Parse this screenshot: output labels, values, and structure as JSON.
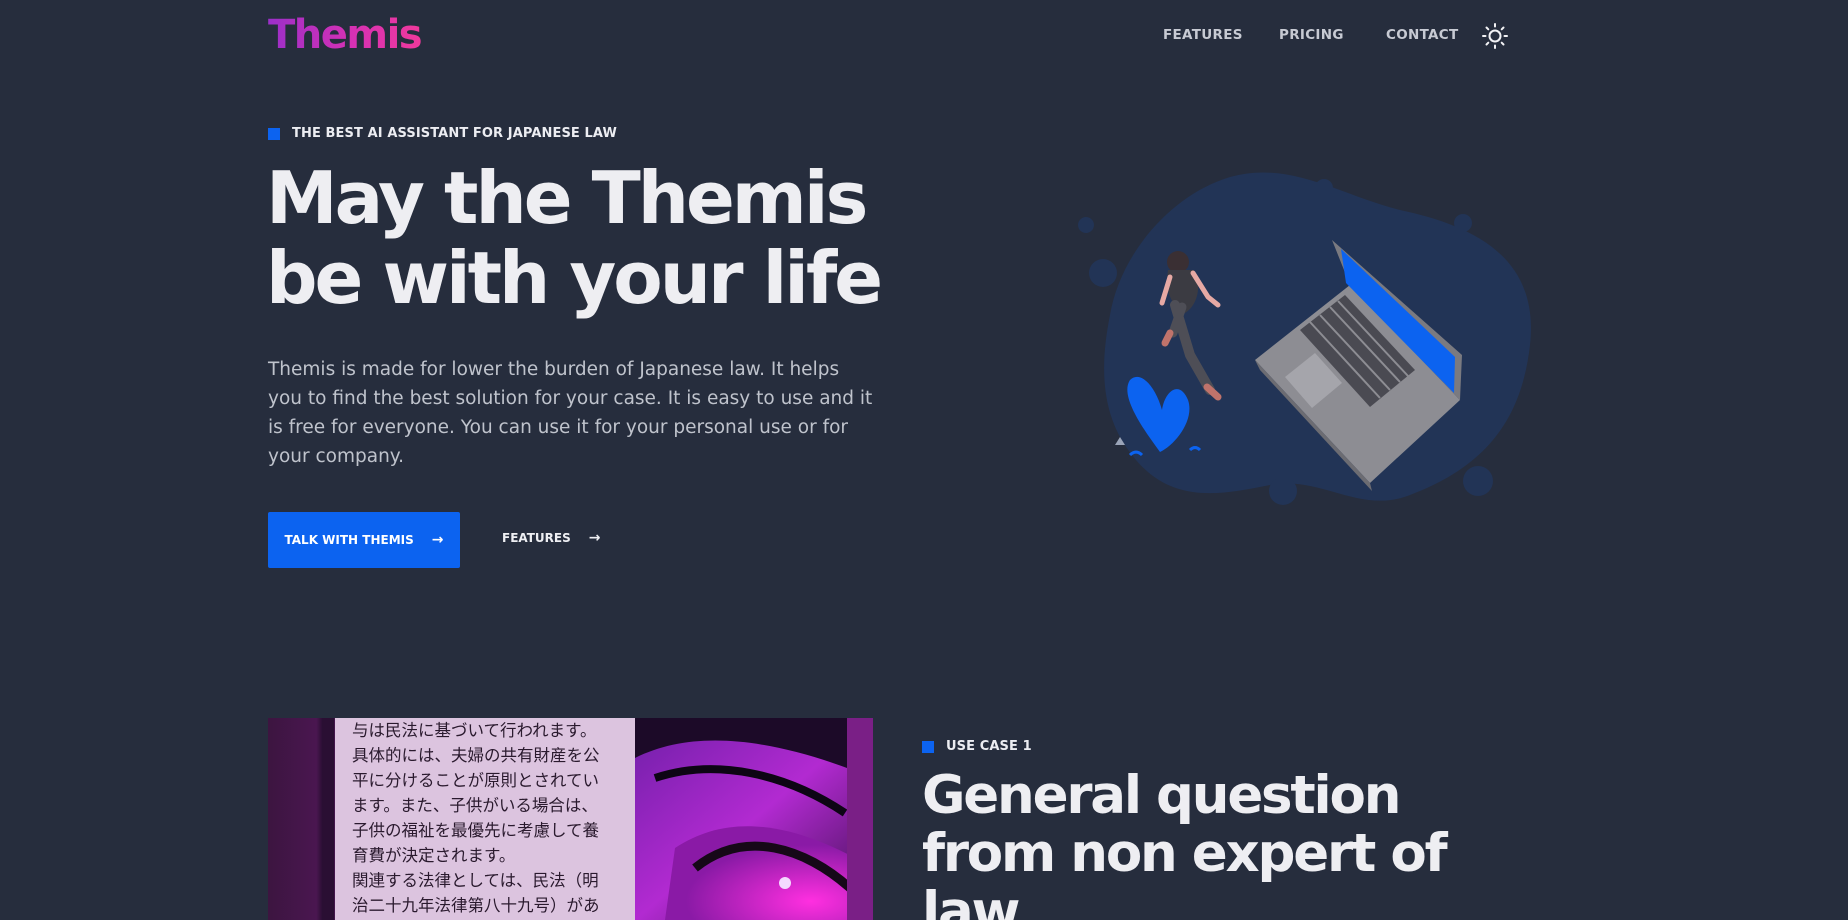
{
  "nav": {
    "logo": "Themis",
    "links": [
      "FEATURES",
      "PRICING",
      "CONTACT"
    ],
    "theme_icon": "sun-icon"
  },
  "hero": {
    "eyebrow": "THE BEST AI ASSISTANT FOR JAPANESE LAW",
    "title_line1": "May the Themis",
    "title_line2": "be with your life",
    "description": "Themis is made for lower the burden of Japanese law. It helps you to find the best solution for your case. It is easy to use and it is free for everyone. You can use it for your personal use or for your company.",
    "primary_button": "TALK WITH THEMIS",
    "secondary_button": "FEATURES",
    "arrow": "→"
  },
  "use_case": {
    "eyebrow": "USE CASE 1",
    "title": "General question from non expert of law",
    "image_text": "与は民法に基づいて行われます。\n具体的には、夫婦の共有財産を公\n平に分けることが原則とされてい\nます。また、子供がいる場合は、\n子供の福祉を最優先に考慮して養\n育費が決定されます。\n関連する法律としては、民法（明\n治二十九年法律第八十九号）があ"
  },
  "colors": {
    "background": "#262d3d",
    "accent": "#0c63f0",
    "logo_gradient": [
      "#9b2fc9",
      "#f0399c"
    ]
  }
}
